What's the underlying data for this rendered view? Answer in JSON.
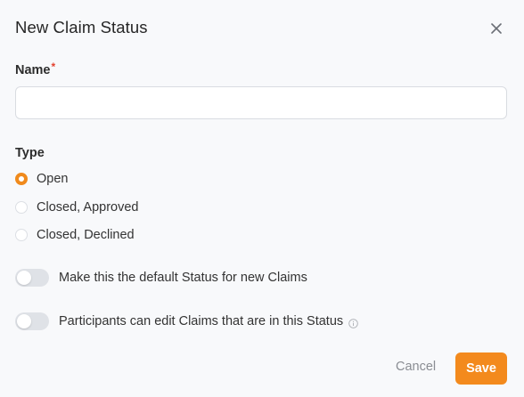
{
  "dialog": {
    "title": "New Claim Status",
    "close_icon": "close-icon"
  },
  "name_field": {
    "label": "Name",
    "required_marker": "*",
    "value": "",
    "placeholder": ""
  },
  "type_field": {
    "label": "Type",
    "options": [
      {
        "label": "Open",
        "selected": true
      },
      {
        "label": "Closed, Approved",
        "selected": false
      },
      {
        "label": "Closed, Declined",
        "selected": false
      }
    ]
  },
  "toggles": [
    {
      "label": "Make this the default Status for new Claims",
      "on": false
    },
    {
      "label": "Participants can edit Claims that are in this Status",
      "on": false,
      "info_icon": "info-icon"
    }
  ],
  "actions": {
    "cancel_label": "Cancel",
    "save_label": "Save"
  },
  "colors": {
    "accent": "#f38a1d",
    "required": "#e3412f",
    "muted": "#8a8d93"
  }
}
